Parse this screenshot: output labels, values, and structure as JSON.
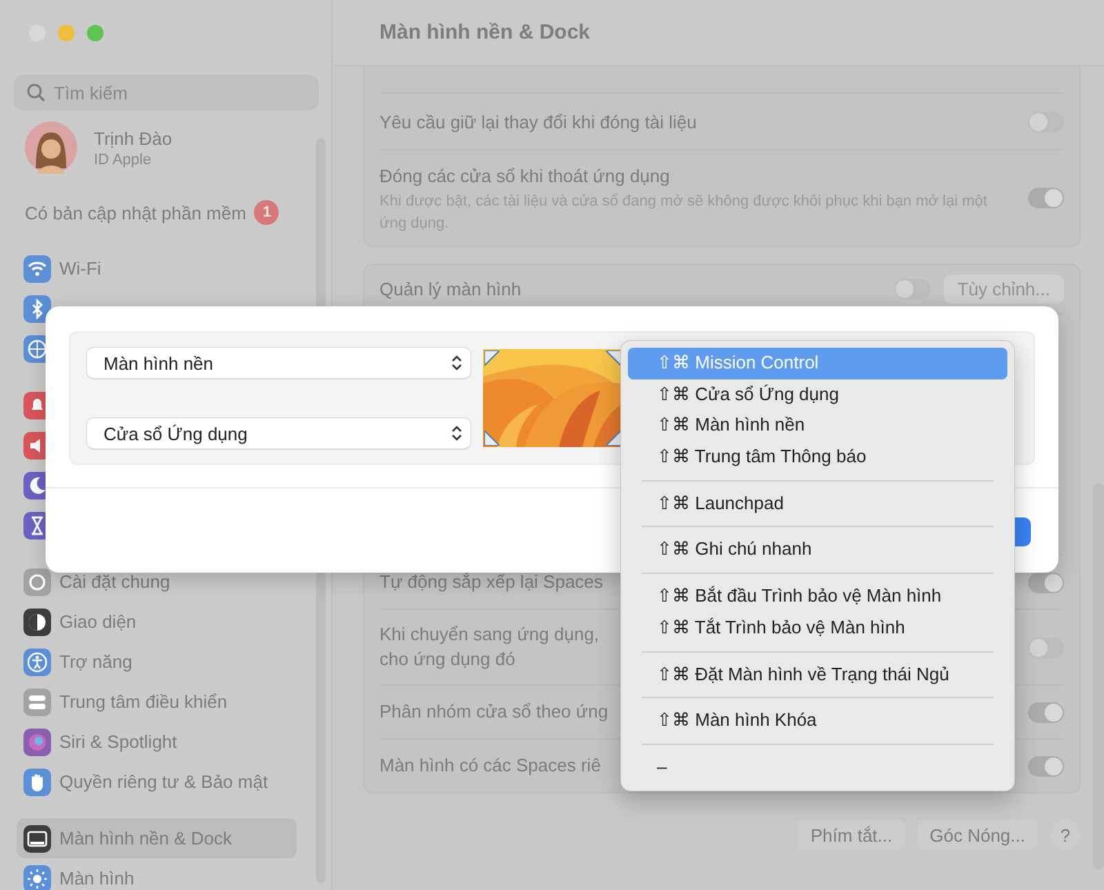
{
  "window": {
    "title": "Màn hình nền & Dock"
  },
  "sidebar": {
    "search": {
      "placeholder": "Tìm kiếm"
    },
    "account": {
      "name": "Trịnh Đào",
      "subtitle": "ID Apple"
    },
    "update": {
      "label": "Có bản cập nhật phần mềm",
      "badge": "1"
    },
    "sections": [
      [
        {
          "label": "Wi-Fi",
          "color": "#5b8fd6",
          "selected": false
        },
        {
          "color": "#5b8fd6",
          "selected": false
        },
        {
          "color": "#5b8fd6",
          "selected": false
        }
      ],
      [
        {
          "color": "#d9565a",
          "selected": false
        },
        {
          "color": "#d9565a",
          "selected": false
        },
        {
          "color": "#6c62c4",
          "selected": false
        },
        {
          "color": "#6c62c4",
          "selected": false
        }
      ],
      [
        {
          "label": "Cài đặt chung",
          "color": "#a3a3a3",
          "selected": false
        },
        {
          "label": "Giao diện",
          "color": "#3d3d3d",
          "selected": false
        },
        {
          "label": "Trợ năng",
          "color": "#5b8fd6",
          "selected": false
        },
        {
          "label": "Trung tâm điều khiển",
          "color": "#a3a3a3",
          "selected": false
        },
        {
          "label": "Siri & Spotlight",
          "color": "#8a5fb0",
          "selected": false
        },
        {
          "label": "Quyền riêng tư & Bảo mật",
          "color": "#5b8fd6",
          "selected": false
        }
      ],
      [
        {
          "label": "Màn hình nền & Dock",
          "color": "#3d3d3d",
          "selected": true
        },
        {
          "label": "Màn hình",
          "color": "#5b8fd6",
          "selected": false
        }
      ]
    ]
  },
  "main": {
    "groups": [
      {
        "rows": [
          {
            "lines": [
              "Yêu cầu giữ lại thay đổi khi đóng tài liệu"
            ],
            "on": false
          },
          {
            "lines": [
              "Đóng các cửa sổ khi thoát ứng dụng"
            ],
            "description": "Khi được bật, các tài liệu và cửa sổ đang mở sẽ không được khôi phục khi bạn mở lại một ứng dụng.",
            "on": true
          }
        ]
      },
      {
        "rows": [
          {
            "lines": [
              "Quản lý màn hình"
            ],
            "on": false,
            "button": {
              "label": "Tùy chỉnh...",
              "disabled": true
            }
          }
        ],
        "lower_rows": [
          {
            "lines": [
              "Tự động sắp xếp lại Spaces"
            ],
            "on": true
          },
          {
            "lines": [
              "Khi chuyển sang ứng dụng,",
              "cho ứng dụng đó"
            ],
            "on": false
          },
          {
            "lines": [
              "Phân nhóm cửa sổ theo ứng"
            ],
            "on": true
          },
          {
            "lines": [
              "Màn hình có các Spaces riê"
            ],
            "on": true
          }
        ]
      }
    ],
    "buttons": [
      "Phím tắt...",
      "Góc Nóng...",
      "?"
    ]
  },
  "dialog": {
    "corners": [
      {
        "value": "Màn hình nền"
      },
      {
        "value": "Cửa sổ Ứng dụng"
      }
    ]
  },
  "menu": {
    "groups": [
      [
        {
          "label": "⇧⌘ Mission Control",
          "selected": true
        },
        {
          "label": "⇧⌘ Cửa sổ Ứng dụng",
          "selected": false
        },
        {
          "label": "⇧⌘ Màn hình nền",
          "selected": false
        },
        {
          "label": "⇧⌘ Trung tâm Thông báo",
          "selected": false
        }
      ],
      [
        {
          "label": "⇧⌘ Launchpad",
          "selected": false
        }
      ],
      [
        {
          "label": "⇧⌘ Ghi chú nhanh",
          "selected": false
        }
      ],
      [
        {
          "label": "⇧⌘ Bắt đầu Trình bảo vệ Màn hình",
          "selected": false
        },
        {
          "label": "⇧⌘ Tắt Trình bảo vệ Màn hình",
          "selected": false
        }
      ],
      [
        {
          "label": "⇧⌘ Đặt Màn hình về Trạng thái Ngủ",
          "selected": false
        }
      ],
      [
        {
          "label": "⇧⌘ Màn hình Khóa",
          "selected": false
        }
      ],
      [
        {
          "label": "–",
          "selected": false
        }
      ]
    ]
  }
}
